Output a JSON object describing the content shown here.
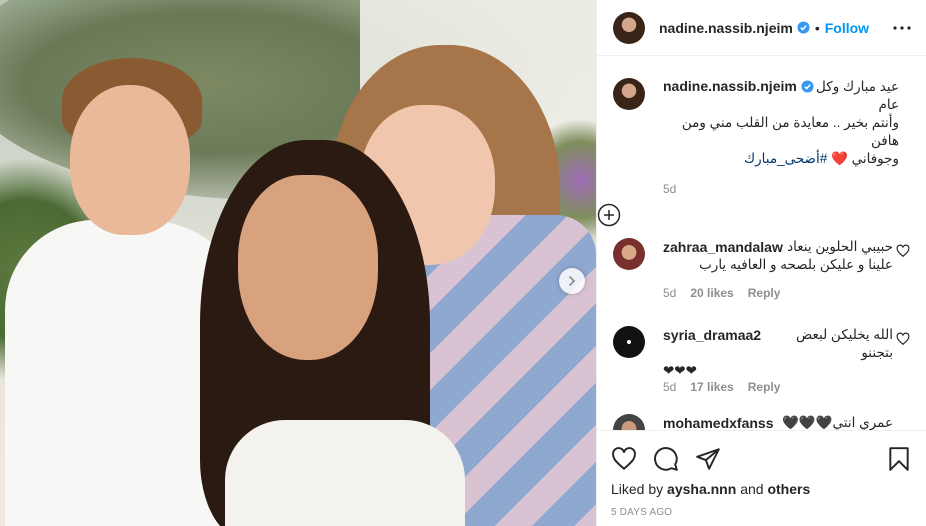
{
  "header": {
    "username": "nadine.nassib.njeim",
    "dot": "•",
    "follow_label": "Follow"
  },
  "caption": {
    "username": "nadine.nassib.njeim",
    "line1": "عيد مبارك وكل عام",
    "line2": "وأنتم بخير .. معايدة من القلب مني ومن هافن",
    "line3_prefix": "وجوفاني ❤️ ",
    "hashtag": "#أضحى_مبارك",
    "age": "5d"
  },
  "comments": [
    {
      "username": "zahraa_mandalaw",
      "text_line1": "حبيبي الحلوين ينعاد",
      "text_line2": "علينا و عليكن بلصحه و العافيه يارب",
      "age": "5d",
      "likes": "20 likes",
      "reply": "Reply"
    },
    {
      "username": "syria_dramaa2",
      "text_line1": "الله يخليكن لبعض بتجننو",
      "text_line2": "❤❤❤",
      "age": "5d",
      "likes": "17 likes",
      "reply": "Reply"
    },
    {
      "username": "mohamedxfanss",
      "text_line1": "عمري انتي🖤🖤🖤",
      "age": "",
      "likes": "",
      "reply": ""
    }
  ],
  "footer": {
    "liked_by_prefix": "Liked by",
    "liked_by_user": "aysha.nnn",
    "liked_by_and": "and",
    "liked_by_others": "others",
    "time": "5 DAYS AGO"
  },
  "icons": {
    "verified": "verified-badge-icon",
    "more": "more-options-icon",
    "load_more": "load-more-comments-icon",
    "heart": "heart-icon",
    "comment": "comment-icon",
    "share": "share-icon",
    "save": "save-icon",
    "next": "chevron-right-icon"
  },
  "colors": {
    "accent": "#0095f6",
    "verified": "#3897f0",
    "muted": "#8e8e8e",
    "text": "#262626"
  }
}
